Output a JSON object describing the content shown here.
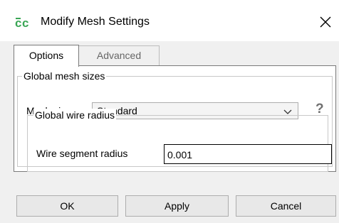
{
  "window": {
    "title": "Modify Mesh Settings",
    "app_icon": "cadfeko-icon",
    "close_icon": "close-icon"
  },
  "tabs": [
    {
      "label": "Options",
      "selected": true
    },
    {
      "label": "Advanced",
      "selected": false
    }
  ],
  "global_mesh_sizes": {
    "legend": "Global mesh sizes",
    "mesh_size_label": "Mesh size",
    "mesh_size_value": "Standard",
    "help_glyph": "?"
  },
  "global_wire_radius": {
    "legend": "Global wire radius",
    "segment_radius_label": "Wire segment radius",
    "segment_radius_value": "0.001"
  },
  "buttons": {
    "ok": "OK",
    "apply": "Apply",
    "cancel": "Cancel"
  },
  "colors": {
    "app_icon_green": "#3aa655",
    "help_gray": "#707070"
  }
}
